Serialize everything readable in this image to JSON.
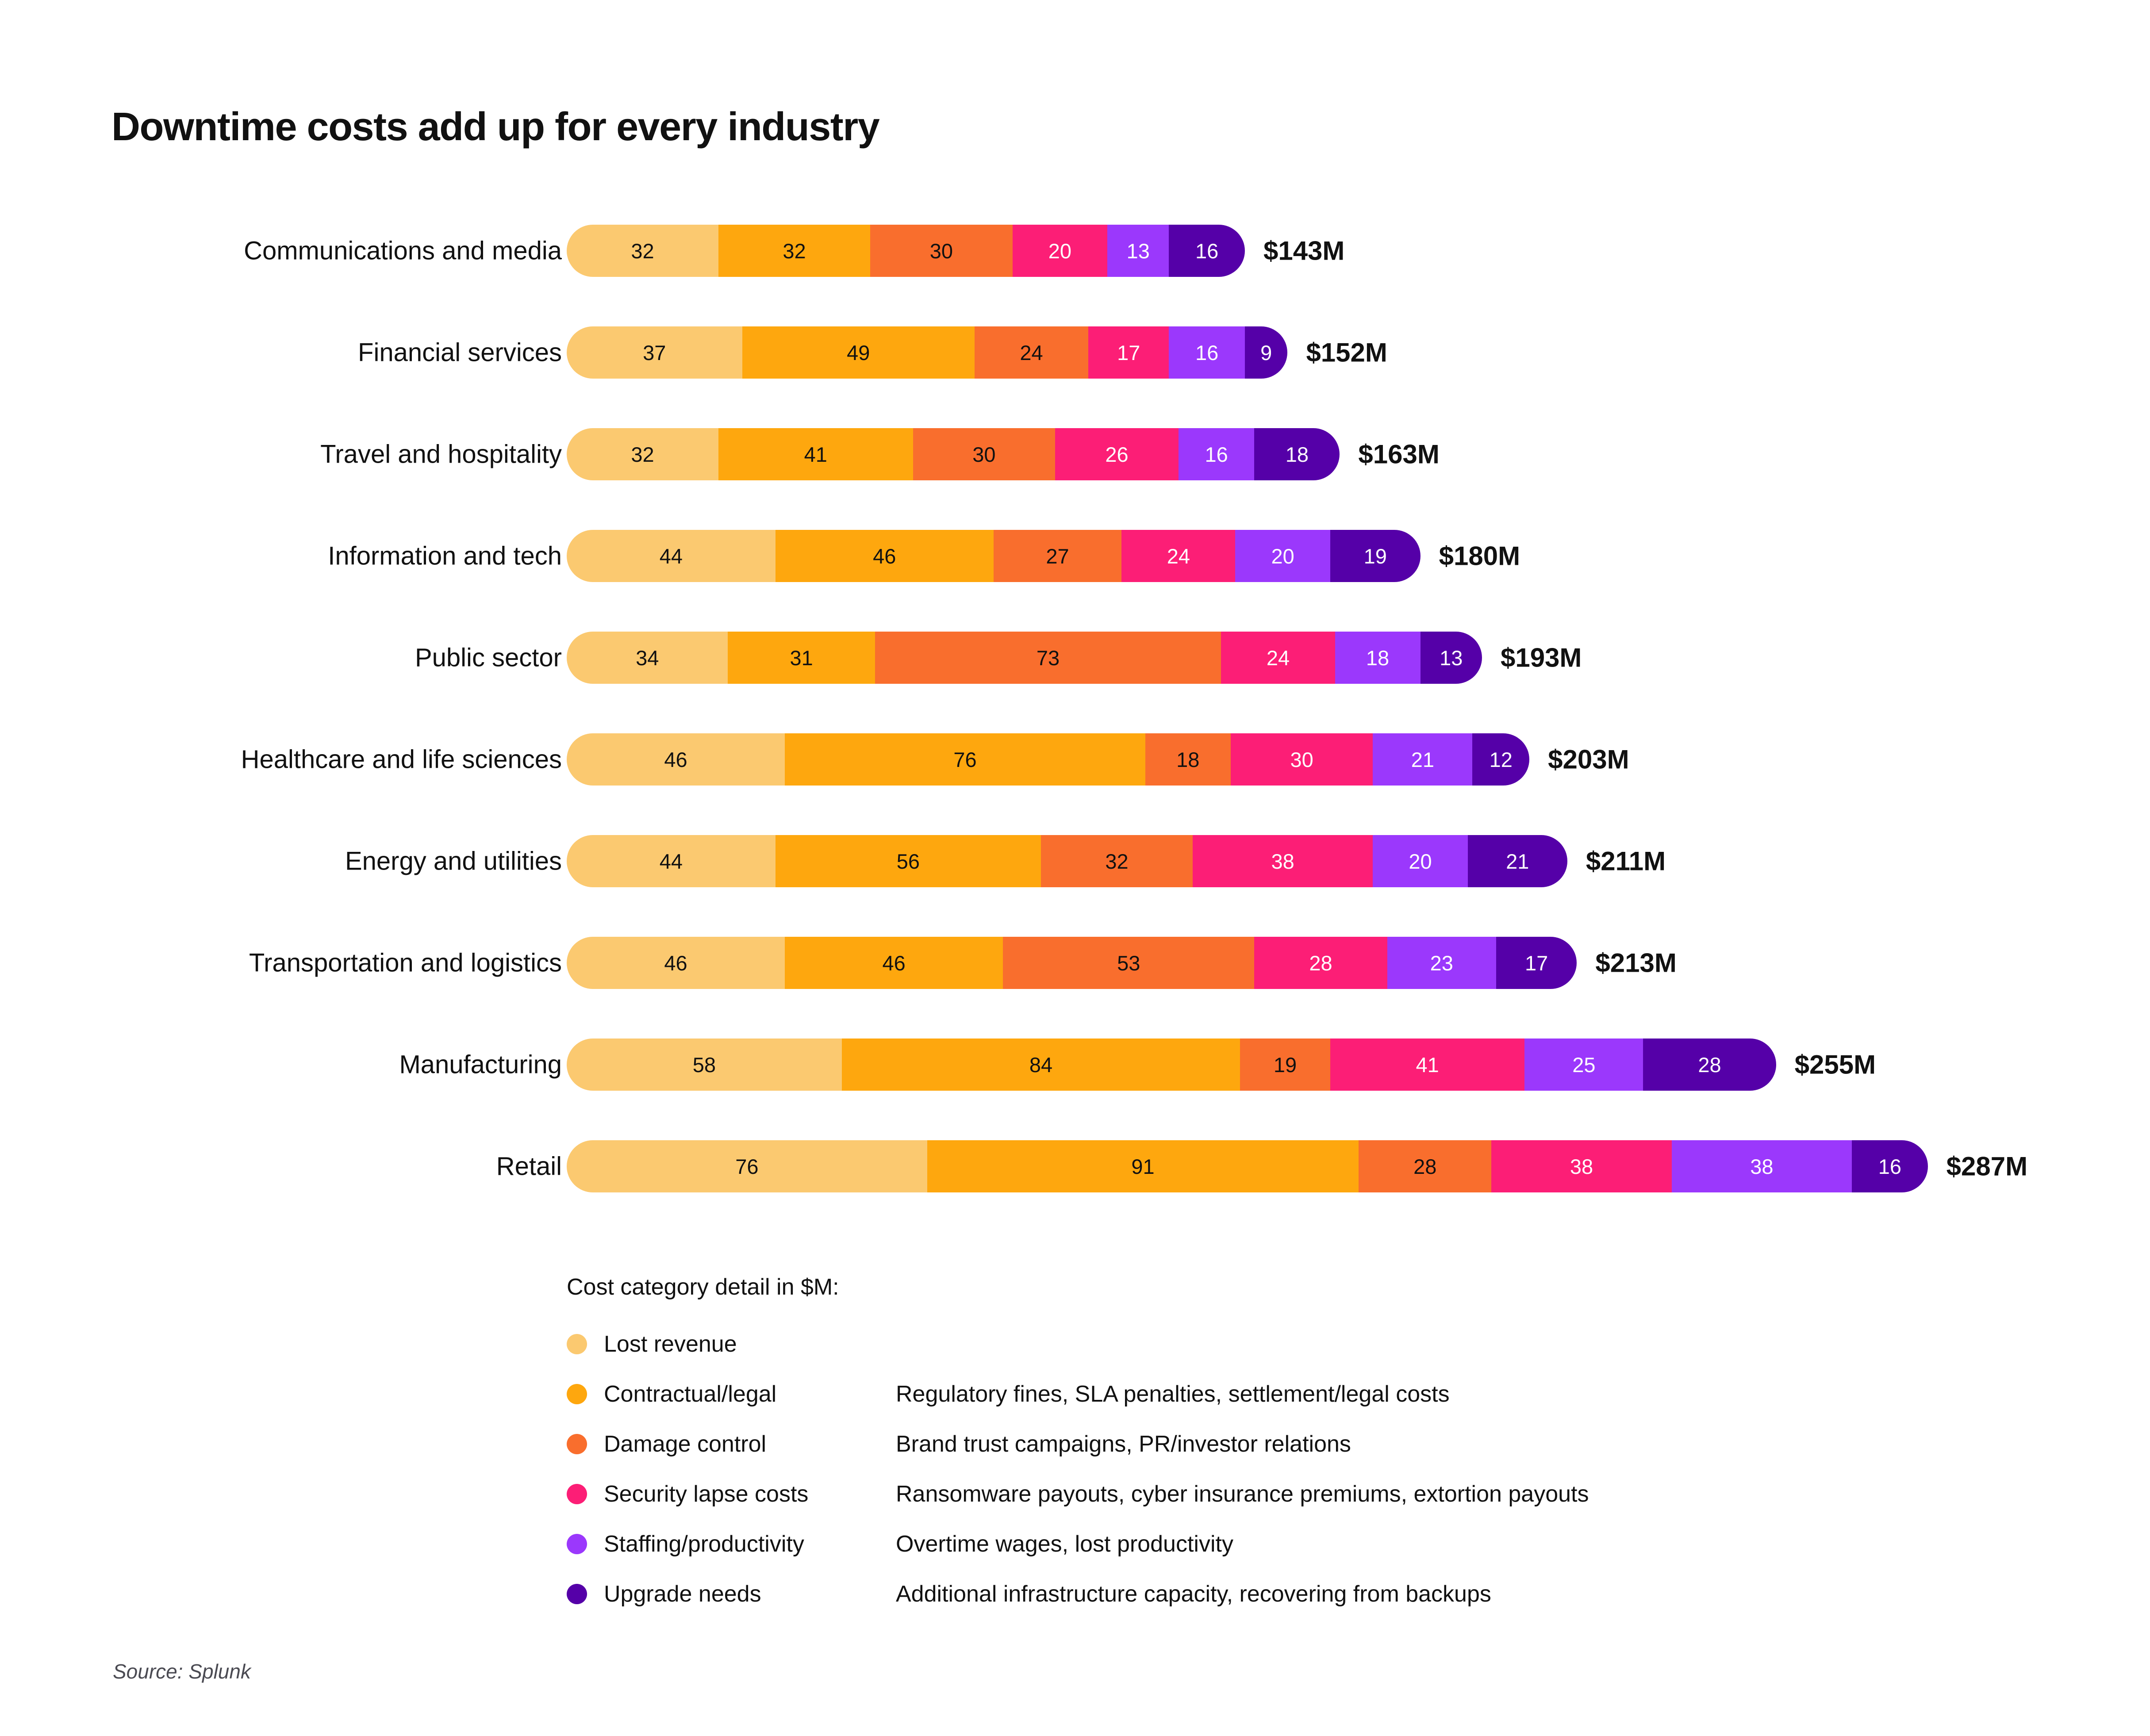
{
  "title": "Downtime costs add up for every industry",
  "source": "Source: Splunk",
  "legend": {
    "title": "Cost category detail in $M:",
    "items": [
      {
        "label": "Lost revenue",
        "desc": "",
        "color": "#FBC970"
      },
      {
        "label": "Contractual/legal",
        "desc": "Regulatory fines, SLA penalties, settlement/legal costs",
        "color": "#FEA70E"
      },
      {
        "label": "Damage control",
        "desc": "Brand trust campaigns, PR/investor relations",
        "color": "#F96E2D"
      },
      {
        "label": "Security lapse costs",
        "desc": "Ransomware payouts, cyber insurance premiums, extortion payouts",
        "color": "#FC1E76"
      },
      {
        "label": "Staffing/productivity",
        "desc": "Overtime wages, lost productivity",
        "color": "#9B38FC"
      },
      {
        "label": "Upgrade needs",
        "desc": "Additional infrastructure capacity, recovering from backups",
        "color": "#5500A8"
      }
    ]
  },
  "chart_data": {
    "type": "bar",
    "subtype": "stacked-horizontal",
    "title": "Downtime costs add up for every industry",
    "xlabel": "",
    "ylabel": "",
    "unit": "$M",
    "legend_position": "bottom",
    "grid": false,
    "series": [
      {
        "name": "Lost revenue",
        "color": "#FBC970",
        "label_color": "dark",
        "values": [
          32,
          37,
          32,
          44,
          34,
          46,
          44,
          46,
          58,
          76
        ]
      },
      {
        "name": "Contractual/legal",
        "color": "#FEA70E",
        "label_color": "dark",
        "values": [
          32,
          49,
          41,
          46,
          31,
          76,
          56,
          46,
          84,
          91
        ]
      },
      {
        "name": "Damage control",
        "color": "#F96E2D",
        "label_color": "dark",
        "values": [
          30,
          24,
          30,
          27,
          73,
          18,
          32,
          53,
          19,
          28
        ]
      },
      {
        "name": "Security lapse costs",
        "color": "#FC1E76",
        "label_color": "light",
        "values": [
          20,
          17,
          26,
          24,
          24,
          30,
          38,
          28,
          41,
          38
        ]
      },
      {
        "name": "Staffing/productivity",
        "color": "#9B38FC",
        "label_color": "light",
        "values": [
          13,
          16,
          16,
          20,
          18,
          21,
          20,
          23,
          25,
          38
        ]
      },
      {
        "name": "Upgrade needs",
        "color": "#5500A8",
        "label_color": "light",
        "values": [
          16,
          9,
          18,
          19,
          13,
          12,
          21,
          17,
          28,
          16
        ]
      }
    ],
    "categories": [
      "Communications and media",
      "Financial services",
      "Travel and hospitality",
      "Information and tech",
      "Public sector",
      "Healthcare and life sciences",
      "Energy and utilities",
      "Transportation and logistics",
      "Manufacturing",
      "Retail"
    ],
    "totals": [
      "$143M",
      "$152M",
      "$163M",
      "$180M",
      "$193M",
      "$203M",
      "$211M",
      "$213M",
      "$255M",
      "$287M"
    ],
    "total_values": [
      143,
      152,
      163,
      180,
      193,
      203,
      211,
      213,
      255,
      287
    ],
    "rows": [
      {
        "label": "Communications and media",
        "total": "$143M",
        "values": [
          32,
          32,
          30,
          20,
          13,
          16
        ]
      },
      {
        "label": "Financial services",
        "total": "$152M",
        "values": [
          37,
          49,
          24,
          17,
          16,
          9
        ]
      },
      {
        "label": "Travel and hospitality",
        "total": "$163M",
        "values": [
          32,
          41,
          30,
          26,
          16,
          18
        ]
      },
      {
        "label": "Information and tech",
        "total": "$180M",
        "values": [
          44,
          46,
          27,
          24,
          20,
          19
        ]
      },
      {
        "label": "Public sector",
        "total": "$193M",
        "values": [
          34,
          31,
          73,
          24,
          18,
          13
        ]
      },
      {
        "label": "Healthcare and life sciences",
        "total": "$203M",
        "values": [
          46,
          76,
          18,
          30,
          21,
          12
        ]
      },
      {
        "label": "Energy and utilities",
        "total": "$211M",
        "values": [
          44,
          56,
          32,
          38,
          20,
          21
        ]
      },
      {
        "label": "Transportation and logistics",
        "total": "$213M",
        "values": [
          46,
          46,
          53,
          28,
          23,
          17
        ]
      },
      {
        "label": "Manufacturing",
        "total": "$255M",
        "values": [
          58,
          84,
          19,
          41,
          25,
          28
        ]
      },
      {
        "label": "Retail",
        "total": "$287M",
        "values": [
          76,
          91,
          28,
          38,
          38,
          16
        ]
      }
    ]
  }
}
